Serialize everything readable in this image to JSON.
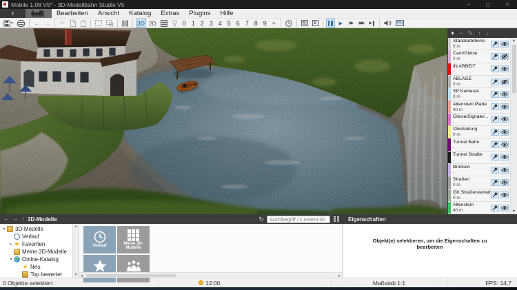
{
  "window": {
    "title": "Mobile 1.08 V5* - 3D-Modellbahn Studio V5",
    "controls": {
      "minimize": "−",
      "maximize": "◻",
      "close": "×"
    }
  },
  "menu": {
    "back_glyph": "‹",
    "items": [
      "Bearbeiten",
      "Ansicht",
      "Katalog",
      "Extras",
      "Plugins",
      "Hilfe"
    ]
  },
  "icons": {
    "save_caret": "▾",
    "undo": "←",
    "redo": "→",
    "cut": "✂",
    "play": "▶",
    "fast_forward": "▶▶",
    "fastest_forward": "▶▶▶",
    "skip_end": "▶",
    "refresh": "↻",
    "scroll_up": "▲",
    "scroll_down": "▼",
    "scroll_left": "◂",
    "scroll_right": "▸",
    "star": "★"
  },
  "toolbar": {
    "view_3d": "3D",
    "view_2d": "2D",
    "camera_numbers": [
      "0",
      "1",
      "2",
      "3",
      "4",
      "5",
      "6",
      "7",
      "8",
      "9"
    ],
    "add_camera": "+"
  },
  "layers": {
    "tools": {
      "add": "+",
      "remove": "−",
      "edit": "✎",
      "move_up": "↑",
      "move_down": "↓"
    },
    "items": [
      {
        "name": "Standardebene",
        "height": "0 m",
        "color": "#cdcdcd",
        "hidden": false
      },
      {
        "name": "Cam/Gleise",
        "height": "0 m",
        "color": "#d9aed6",
        "hidden": true
      },
      {
        "name": "IN ARBEIT",
        "height": "-",
        "color": "#dd1111",
        "hidden": false
      },
      {
        "name": "ABLAGE",
        "height": "0 m",
        "color": "#b5b5b5",
        "hidden": true
      },
      {
        "name": "SP Kameras",
        "height": "0 m",
        "color": "#bfe0ef",
        "hidden": false
      },
      {
        "name": "Altenstein Platte",
        "height": "40 m",
        "color": "#e8a49c",
        "hidden": false
      },
      {
        "name": "Gleise/Signale/...",
        "height": "-",
        "color": "#d976c6",
        "hidden": false
      },
      {
        "name": "Oberleitung",
        "height": "0 m",
        "color": "#f3ee85",
        "hidden": false
      },
      {
        "name": "Tunnel Bahn",
        "height": "-",
        "color": "#6e0a6e",
        "hidden": false
      },
      {
        "name": "Tunnel Straße",
        "height": "-",
        "color": "#1a1a1a",
        "hidden": false
      },
      {
        "name": "Brücken",
        "height": "-",
        "color": "#c7aee4",
        "hidden": false
      },
      {
        "name": "Straßen",
        "height": "0 m",
        "color": "#9d9d9d",
        "hidden": false
      },
      {
        "name": "GK Straßenverkehr",
        "height": "0 m",
        "color": "#9aa89a",
        "hidden": false
      },
      {
        "name": "Altenstein",
        "height": "40 m",
        "color": "#3ec263",
        "hidden": false
      }
    ]
  },
  "catalog": {
    "header": "3D-Modelle",
    "search_placeholder": "Suchbegriff / Content-ID",
    "tree": [
      {
        "label": "3D-Modelle",
        "chevron": "▾"
      },
      {
        "label": "Verlauf",
        "chevron": ""
      },
      {
        "label": "Favoriten",
        "chevron": "▸"
      },
      {
        "label": "Meine 3D-Modelle",
        "chevron": ""
      },
      {
        "label": "Online-Katalog",
        "chevron": "▾"
      },
      {
        "label": "Neu",
        "chevron": ""
      },
      {
        "label": "Top bewertet",
        "chevron": ""
      }
    ],
    "tiles": [
      {
        "label": "Verlauf"
      },
      {
        "label": "Meine 3D-Modelle"
      },
      {
        "label": "Favoriten"
      },
      {
        "label": "Online-Katalog"
      }
    ]
  },
  "properties": {
    "header": "Eigenschaften",
    "empty_text": "Objekt(e) selektieren, um die Eigenschaften zu bearbeiten"
  },
  "statusbar": {
    "selection": "0 Objekte selektiert",
    "time": "12:00",
    "scale": "Maßstab 1:1",
    "fps": "FPS: 14,7"
  }
}
